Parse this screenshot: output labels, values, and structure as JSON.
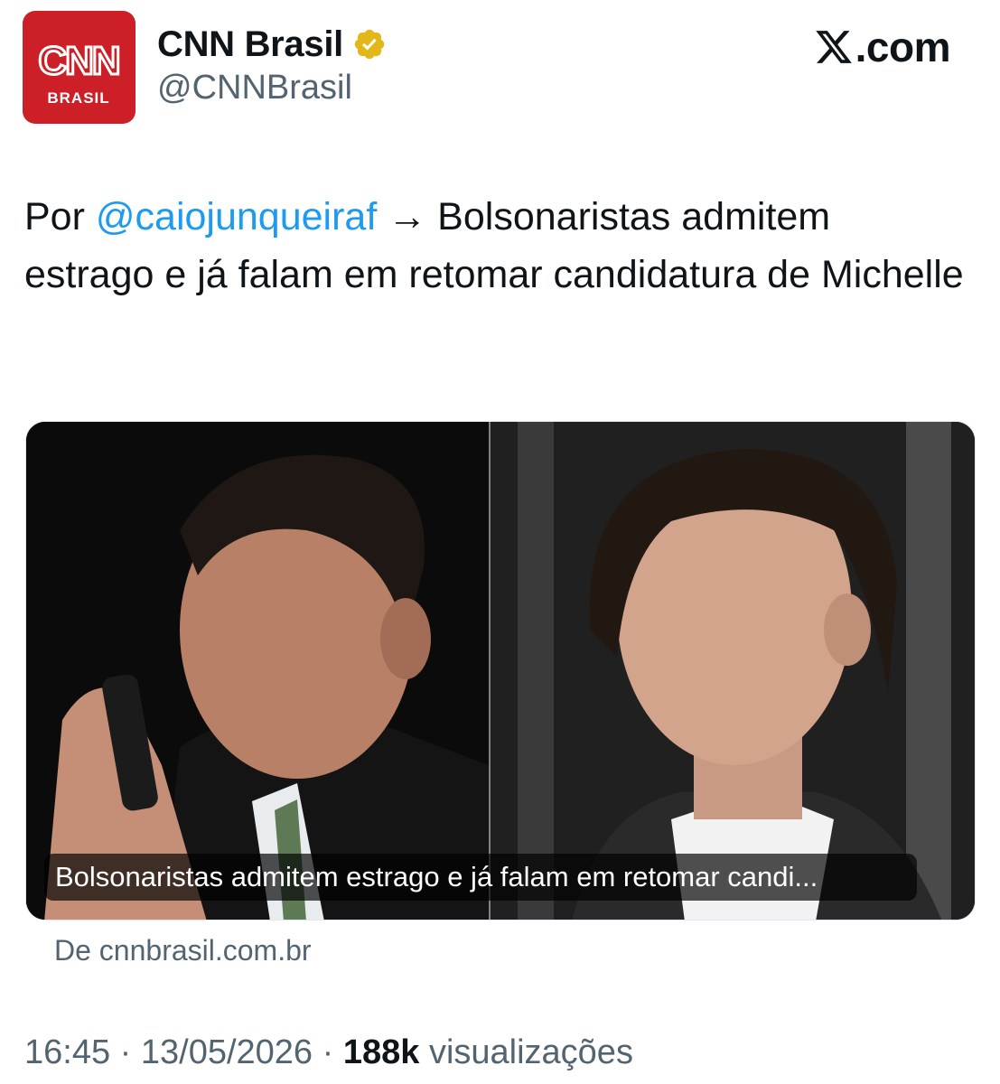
{
  "account": {
    "display_name": "CNN Brasil",
    "handle": "@CNNBrasil",
    "avatar_logo_text": "CNN",
    "avatar_sub_text": "BRASIL",
    "verified_color": "#e2b719"
  },
  "brand": {
    "label": ".com"
  },
  "tweet": {
    "prefix": "Por ",
    "mention": "@caiojunqueiraf",
    "body": " → Bolsonaristas admitem estrago e já falam em retomar candidatura de Michelle"
  },
  "card": {
    "caption": "Bolsonaristas admitem estrago e já falam em retomar candi...",
    "source": "De cnnbrasil.com.br"
  },
  "footer": {
    "time": "16:45",
    "sep1": " · ",
    "date": "13/05/2026",
    "sep2": " · ",
    "views_count": "188k",
    "views_label": " visualizações"
  },
  "colors": {
    "avatar_bg": "#cc1f27",
    "mention": "#1d9bf0",
    "secondary_text": "#536471"
  }
}
